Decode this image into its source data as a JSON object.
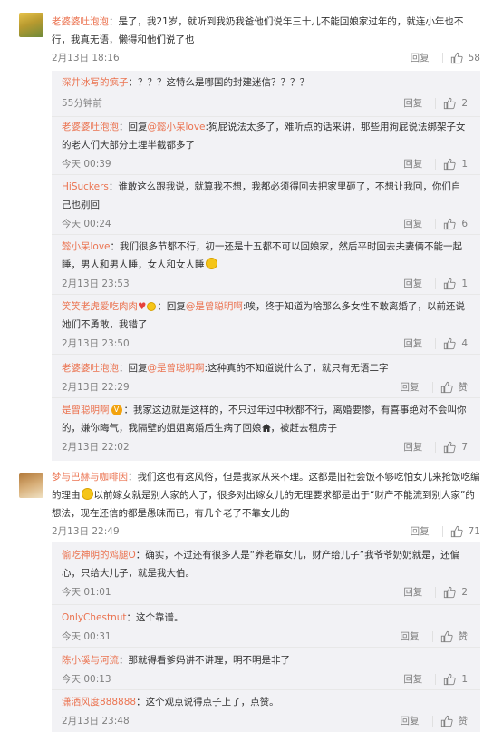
{
  "threads": [
    {
      "user": "老婆婆吐泡泡",
      "text": "是了，我21岁，就听到我奶我爸他们说年三十儿不能回娘家过年的，就连小年也不行，我真无语，懒得和他们说了也",
      "time": "2月13日 18:16",
      "reply_label": "回复",
      "likes": "58",
      "replies": [
        {
          "user": "深井冰写的疯子",
          "text": "？？？这特么是哪国的封建迷信？？？？",
          "time": "55分钟前",
          "reply_label": "回复",
          "likes": "2"
        },
        {
          "user": "老婆婆吐泡泡",
          "pre": "回复",
          "mention": "@懿小呆love",
          "text": "狗屁说法太多了，难听点的话来讲，那些用狗屁说法绑架子女的老人们大部分土埋半截都多了",
          "time": "今天 00:39",
          "reply_label": "回复",
          "likes": "1"
        },
        {
          "user": "HiSuckers",
          "text": "谁敢这么跟我说，就算我不想，我都必须得回去把家里砸了，不想让我回，你们自己也别回",
          "time": "今天 00:24",
          "reply_label": "回复",
          "likes": "6"
        },
        {
          "user": "懿小呆love",
          "text": "我们很多节都不行，初一还是十五都不可以回娘家，然后平时回去夫妻俩不能一起睡，男人和男人睡，女人和女人睡",
          "time": "2月13日 23:53",
          "reply_label": "回复",
          "likes": "1"
        },
        {
          "user": "笑笑老虎爱吃肉肉",
          "pre": "回复",
          "mention": "@是曾聪明啊",
          "text": "唉，终于知道为啥那么多女性不敢离婚了，以前还说她们不勇敢，我错了",
          "time": "2月13日 23:50",
          "reply_label": "回复",
          "likes": "4"
        },
        {
          "user": "老婆婆吐泡泡",
          "pre": "回复",
          "mention": "@是曾聪明啊",
          "text": "这种真的不知道说什么了，就只有无语二字",
          "time": "2月13日 22:29",
          "reply_label": "回复",
          "likes": "赞"
        },
        {
          "user": "是曾聪明啊",
          "text": "我家这边就是这样的，不只过年过中秋都不行，离婚要惨，有喜事绝对不会叫你的，嫌你晦气，我隔壁的姐姐离婚后生病了回娘",
          "text2": "，被赶去租房子",
          "time": "2月13日 22:02",
          "reply_label": "回复",
          "likes": "7"
        }
      ]
    },
    {
      "user": "梦与巴赫与咖啡因",
      "text": "我们这也有这风俗，但是我家从来不理。这都是旧社会饭不够吃怕女儿来抢饭吃编的理由",
      "text2": "以前嫁女就是别人家的人了，很多对出嫁女儿的无理要求都是出于“财产不能流到别人家”的想法，现在还信的都是愚昧而已，有几个老了不靠女儿的",
      "time": "2月13日 22:49",
      "reply_label": "回复",
      "likes": "71",
      "replies": [
        {
          "user": "偷吃神明的鸡腿O",
          "text": "确实，不过还有很多人是“养老靠女儿，财产给儿子”我爷爷奶奶就是，还偏心，只给大儿子，就是我大伯。",
          "time": "今天 01:01",
          "reply_label": "回复",
          "likes": "2"
        },
        {
          "user": "OnlyChestnut",
          "text": "这个靠谱。",
          "time": "今天 00:31",
          "reply_label": "回复",
          "likes": "赞"
        },
        {
          "user": "陈小溪与河流",
          "text": "那就得看爹妈讲不讲理，明不明是非了",
          "time": "今天 00:13",
          "reply_label": "回复",
          "likes": "1"
        },
        {
          "user": "潇洒风度888888",
          "text": "这个观点说得点子上了，点赞。",
          "time": "2月13日 23:48",
          "reply_label": "回复",
          "likes": "赞"
        }
      ]
    }
  ],
  "colors": {
    "username": "#eb7350",
    "meta": "#808080",
    "reply_bg": "#f2f2f5"
  },
  "icons": {
    "like": "thumbs-up-icon",
    "emoji": "emoji-icon",
    "verified": "v-badge-icon",
    "house": "house-icon",
    "heart": "heart-icon"
  }
}
